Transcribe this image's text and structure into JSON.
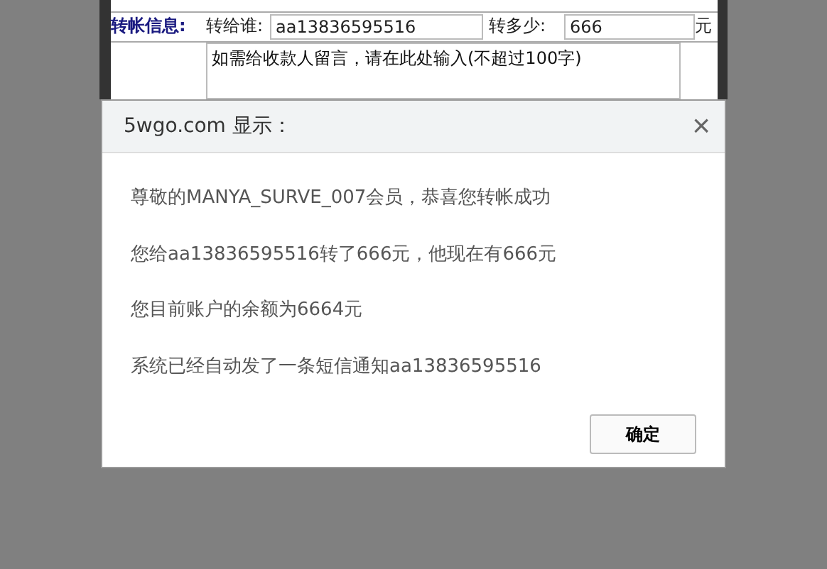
{
  "transfer_form": {
    "section_label": "转帐信息:",
    "recipient_label": "转给谁:",
    "recipient_value": "aa13836595516",
    "amount_label": "转多少:",
    "amount_value": "666",
    "unit": "元",
    "message_value": "如需给收款人留言，请在此处输入(不超过100字)"
  },
  "dialog": {
    "title": "5wgo.com 显示：",
    "close": "×",
    "messages": [
      "尊敬的MANYA_SURVE_007会员，恭喜您转帐成功",
      "您给aa13836595516转了666元，他现在有666元",
      "您目前账户的余额为6664元",
      "系统已经自动发了一条短信通知aa13836595516"
    ],
    "ok_button": "确定"
  }
}
